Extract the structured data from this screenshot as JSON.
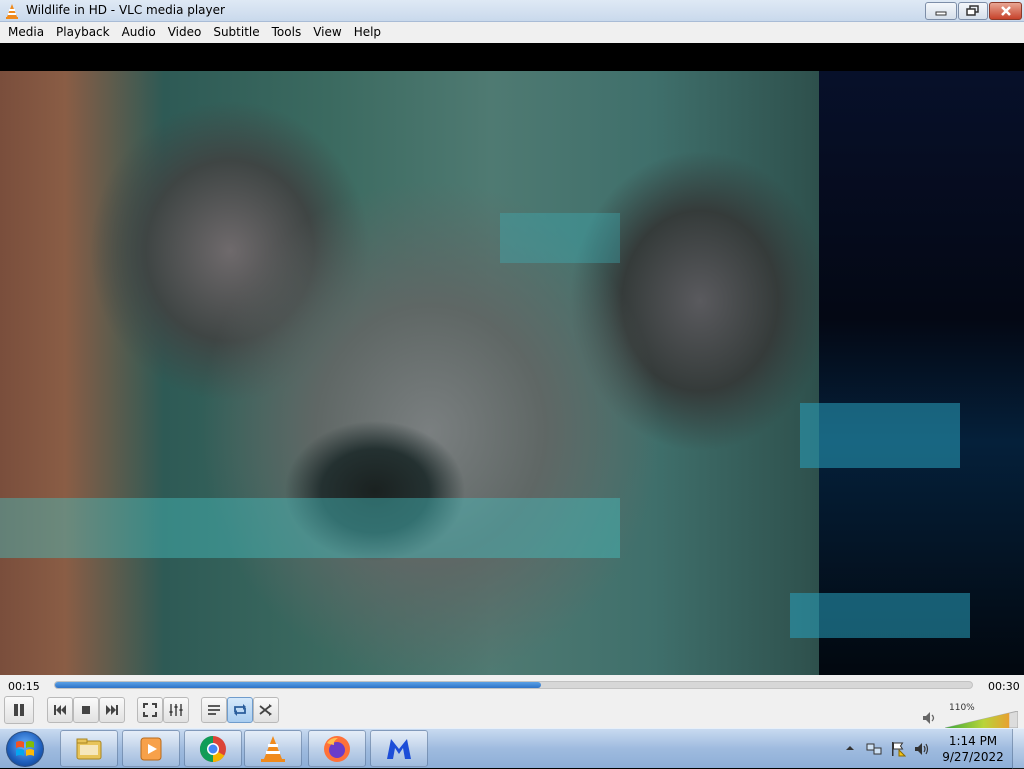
{
  "window": {
    "title": "Wildlife in HD - VLC media player"
  },
  "menu": {
    "items": [
      "Media",
      "Playback",
      "Audio",
      "Video",
      "Subtitle",
      "Tools",
      "View",
      "Help"
    ]
  },
  "player": {
    "elapsed": "00:15",
    "total": "00:30",
    "progress_fraction": 0.53,
    "volume_label": "110%",
    "volume_fraction": 0.88,
    "loop_active": true
  },
  "controls": {
    "icons": [
      "pause-icon",
      "previous-icon",
      "stop-icon",
      "next-icon",
      "fullscreen-icon",
      "extended-settings-icon",
      "playlist-icon",
      "loop-icon",
      "random-icon"
    ]
  },
  "taskbar": {
    "apps": [
      "windows-explorer-icon",
      "windows-media-player-icon",
      "chrome-icon",
      "vlc-icon",
      "firefox-icon",
      "malwarebytes-icon"
    ],
    "clock_time": "1:14 PM",
    "clock_date": "9/27/2022"
  },
  "colors": {
    "seek_fill": "#2e73c8",
    "taskbar": "#9fbbdf",
    "close_button": "#c7432b"
  }
}
